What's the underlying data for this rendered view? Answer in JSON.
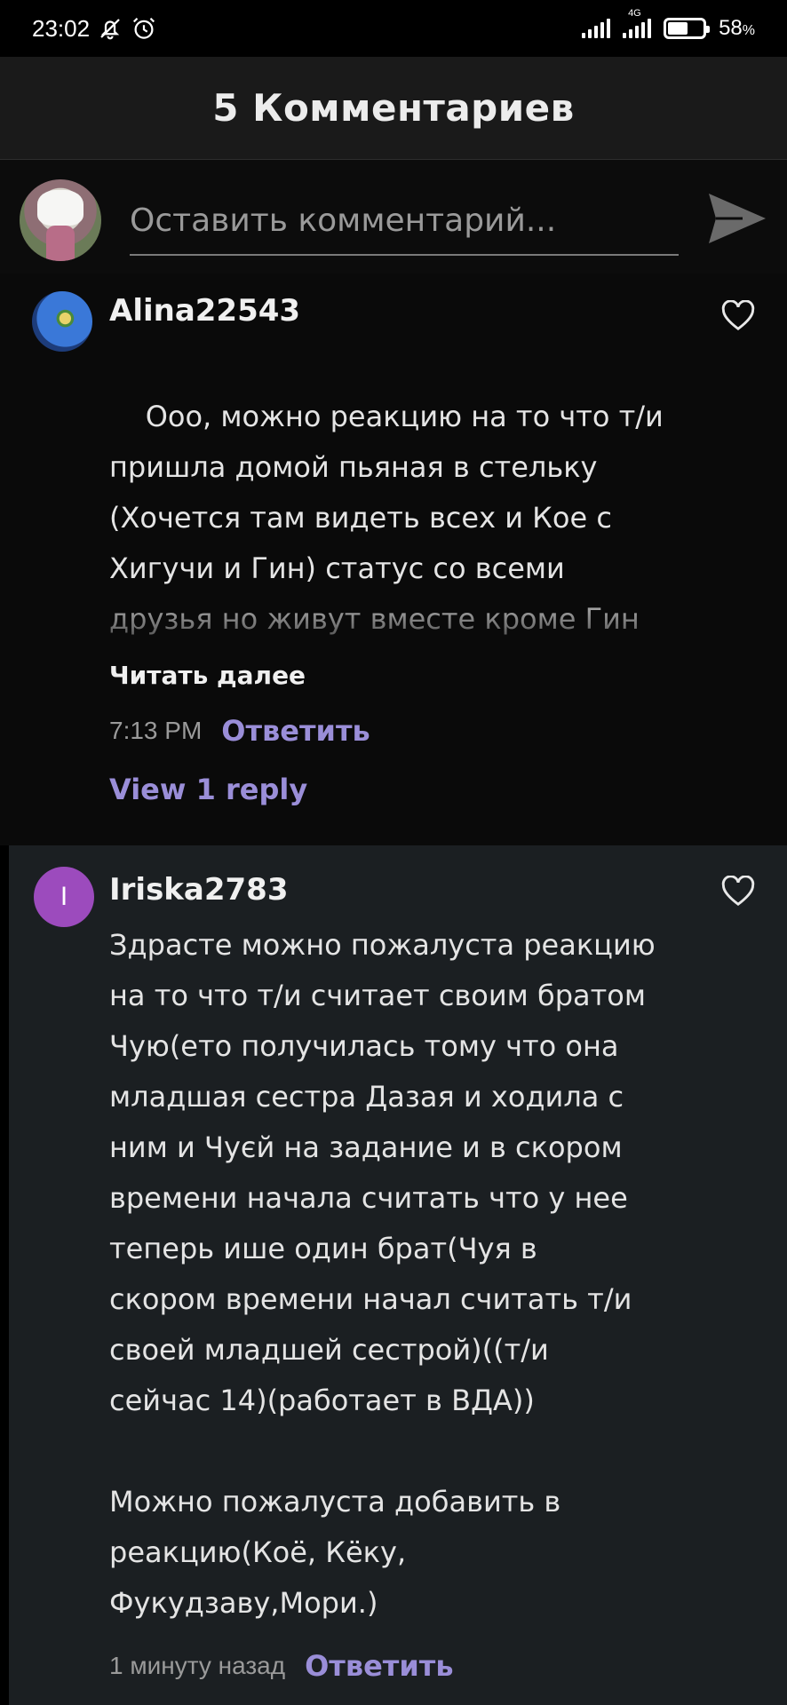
{
  "status_bar": {
    "time": "23:02",
    "network_tag": "4G",
    "battery_percent": "58",
    "battery_unit": "%",
    "battery_level": 0.58,
    "icons": [
      "mute-bell-icon",
      "alarm-icon",
      "signal-icon",
      "lte-signal-icon",
      "battery-icon"
    ]
  },
  "header": {
    "title": "5 Комментариев"
  },
  "compose": {
    "placeholder": "Оставить комментарий...",
    "send_icon": "send-icon"
  },
  "comments": [
    {
      "username": "Alina22543",
      "avatar_icon": "flower-avatar",
      "text": "Ооо, можно реакцию на то что т/и\nпришла домой пьяная в стельку\n(Хочется там видеть всех и Кое с\nХигучи и Гин) статус со всеми\nдрузья но живут вместе кроме Гин\nи Хигучи с ними статус\nвстречаются и живут вместе (да да",
      "read_more": "Читать далее",
      "time": "7:13 PM",
      "reply_label": "Ответить",
      "view_replies": "View 1 reply",
      "like_icon": "heart-outline-icon"
    },
    {
      "username": "Iriska2783",
      "avatar_letter": "I",
      "text": "Здрасте можно пожалуста реакцию\nна то что т/и считает своим братом\nЧую(ето получилась тому что она\nмладшая сестра Дазая и ходила с\nним и Чуєй на задание и в скором\nвремени начала считать что у нее\nтеперь ише один брат(Чуя в\nскором времени начал считать т/и\nсвоей младшей сестрой)((т/и\nсейчас 14)(работает в ВДА))\n\nМожно пожалуста добавить в\nреакцию(Коё, Кёку,\nФукудзаву,Мори.)",
      "time": "1 минуту назад",
      "reply_label": "Ответить",
      "like_icon": "heart-outline-icon"
    }
  ],
  "colors": {
    "background": "#000000",
    "header_bg": "#1a1a1a",
    "highlight_comment_bg": "#1b1f22",
    "accent_link": "#9a8ed8",
    "avatar_purple": "#9c4bbd"
  }
}
